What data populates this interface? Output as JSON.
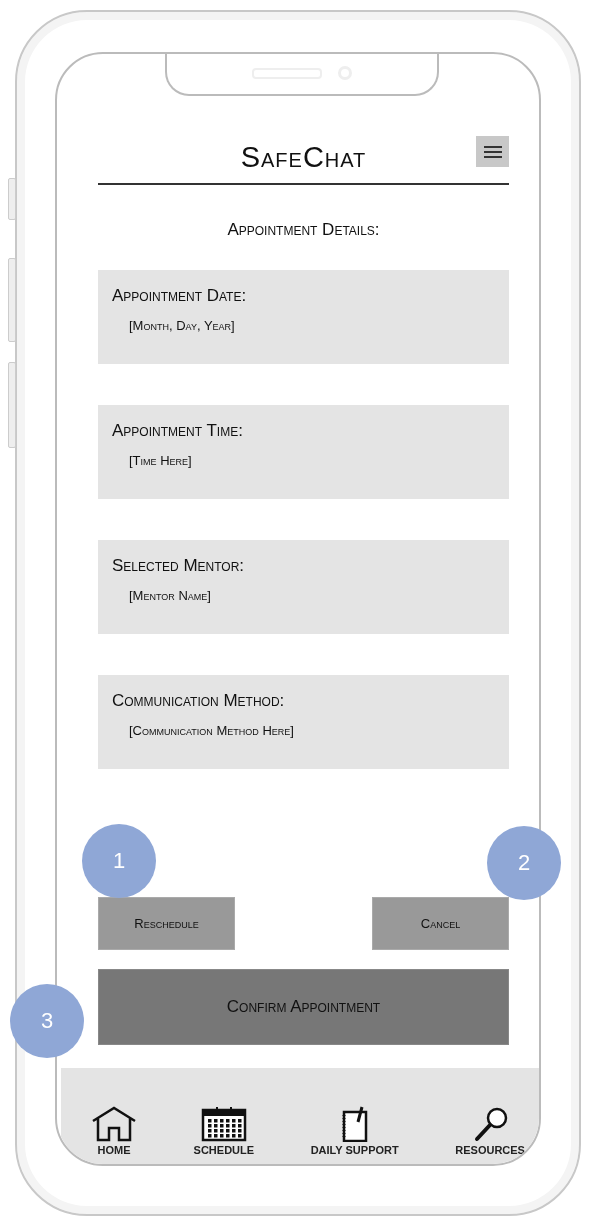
{
  "app": {
    "title": "SafeChat"
  },
  "section_title": "Appointment Details:",
  "fields": [
    {
      "label": "Appointment Date:",
      "value": "[Month, Day, Year]"
    },
    {
      "label": "Appointment Time:",
      "value": "[Time Here]"
    },
    {
      "label": "Selected Mentor:",
      "value": "[Mentor Name]"
    },
    {
      "label": "Communication Method:",
      "value": "[Communication Method Here]"
    }
  ],
  "buttons": [
    {
      "label": "Reschedule"
    },
    {
      "label": "Cancel"
    }
  ],
  "primary_button": {
    "label": "Confirm Appointment"
  },
  "markers": [
    "1",
    "2",
    "3"
  ],
  "nav": [
    {
      "label": "HOME",
      "kind": "home"
    },
    {
      "label": "SCHEDULE",
      "kind": "calendar"
    },
    {
      "label": "DAILY SUPPORT",
      "kind": "notebook"
    },
    {
      "label": "RESOURCES",
      "kind": "search"
    }
  ]
}
